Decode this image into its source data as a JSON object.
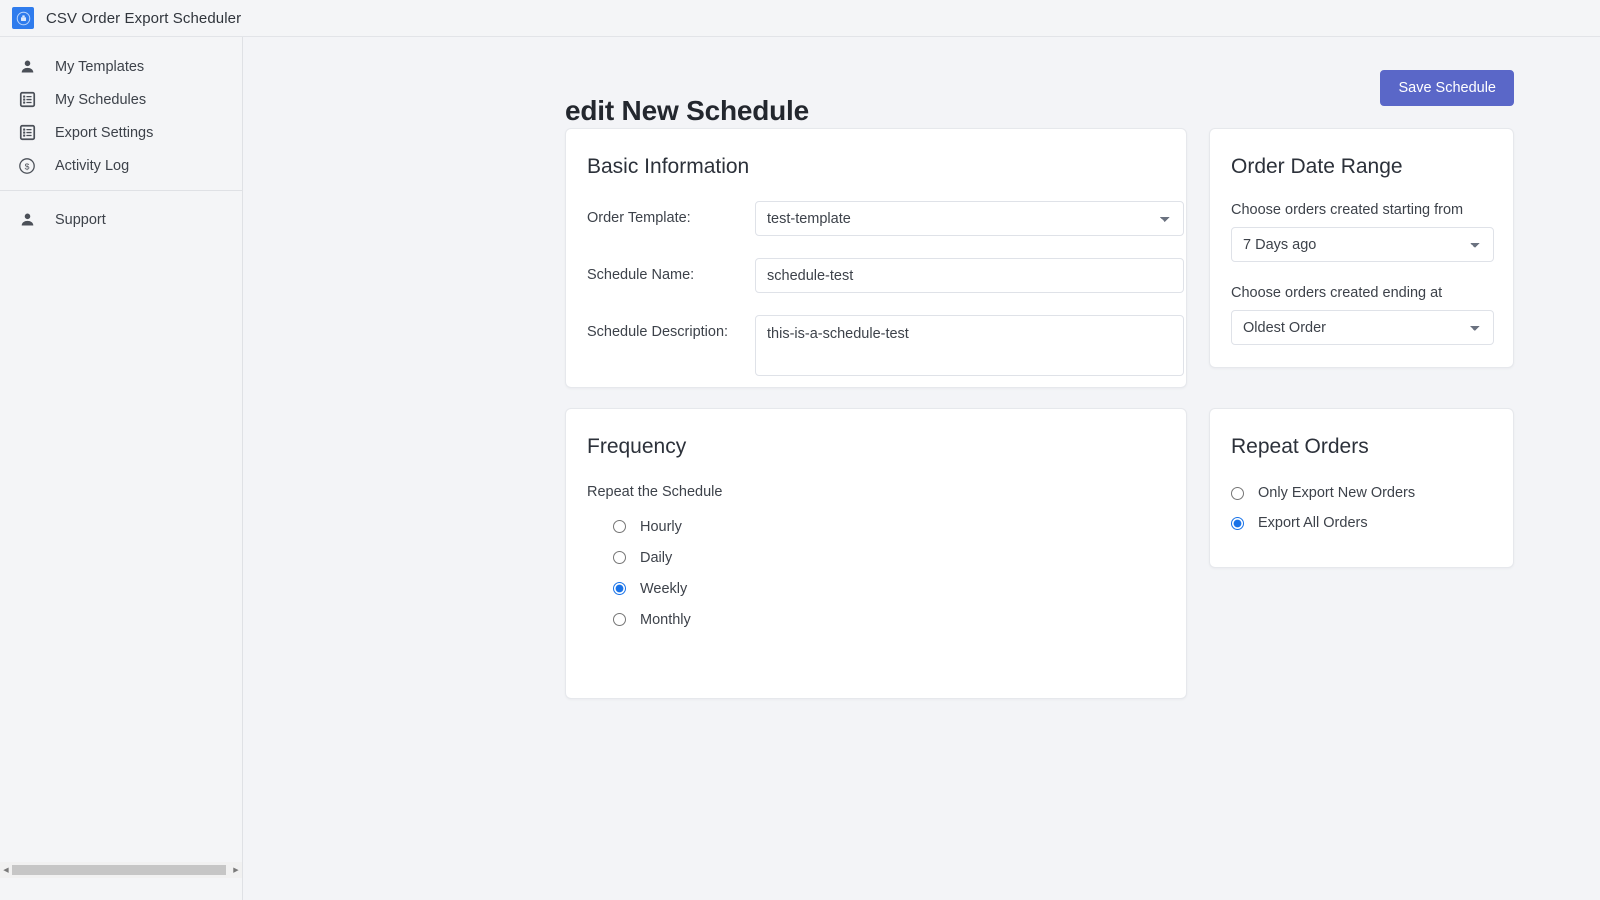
{
  "app": {
    "title": "CSV Order Export Scheduler",
    "logo_icon": "export-scheduler-logo-icon",
    "accent_color": "#5a67c8",
    "radio_color": "#1a73e8",
    "background_color": "#f3f4f7"
  },
  "sidebar": {
    "primary_items": [
      {
        "label": "My Templates",
        "icon": "person-icon"
      },
      {
        "label": "My Schedules",
        "icon": "list-icon"
      },
      {
        "label": "Export Settings",
        "icon": "list-icon"
      },
      {
        "label": "Activity Log",
        "icon": "dollar-circle-icon"
      }
    ],
    "secondary_items": [
      {
        "label": "Support",
        "icon": "person-icon"
      }
    ],
    "scrollbar": {
      "left_arrow_icon": "caret-left-icon",
      "right_arrow_icon": "caret-right-icon"
    }
  },
  "header": {
    "page_title": "edit New Schedule",
    "save_label": "Save Schedule"
  },
  "basic_information": {
    "title": "Basic Information",
    "order_template": {
      "label": "Order Template:",
      "value": "test-template",
      "options": [
        "test-template"
      ]
    },
    "schedule_name": {
      "label": "Schedule Name:",
      "value": "schedule-test",
      "placeholder": ""
    },
    "schedule_description": {
      "label": "Schedule Description:",
      "value": "this-is-a-schedule-test",
      "placeholder": ""
    }
  },
  "order_date_range": {
    "title": "Order Date Range",
    "start": {
      "label": "Choose orders created starting from",
      "value": "7 Days ago",
      "options": [
        "7 Days ago"
      ]
    },
    "end": {
      "label": "Choose orders created ending at",
      "value": "Oldest Order",
      "options": [
        "Oldest Order"
      ]
    }
  },
  "frequency": {
    "title": "Frequency",
    "group_label": "Repeat the Schedule",
    "options": [
      {
        "label": "Hourly",
        "selected": false
      },
      {
        "label": "Daily",
        "selected": false
      },
      {
        "label": "Weekly",
        "selected": true
      },
      {
        "label": "Monthly",
        "selected": false
      }
    ]
  },
  "repeat_orders": {
    "title": "Repeat Orders",
    "options": [
      {
        "label": "Only Export New Orders",
        "selected": false
      },
      {
        "label": "Export All Orders",
        "selected": true
      }
    ]
  }
}
